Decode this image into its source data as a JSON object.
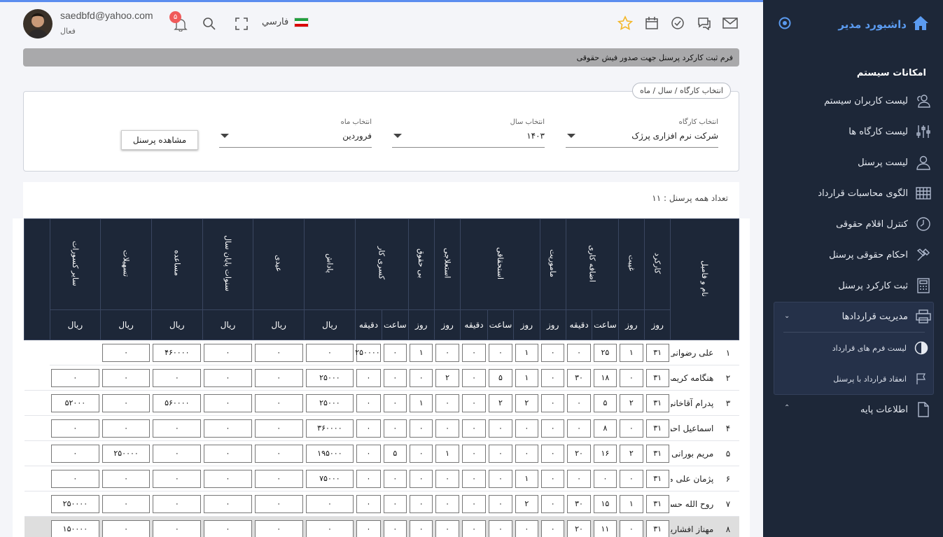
{
  "sidebar": {
    "brand": "داشبورد مدیر",
    "section_title": "امکانات سیستم",
    "items": [
      {
        "label": "لیست کاربران سیستم",
        "icon": "users-icon"
      },
      {
        "label": "لیست کارگاه ها",
        "icon": "sliders-icon"
      },
      {
        "label": "لیست پرسنل",
        "icon": "user-icon"
      },
      {
        "label": "الگوی محاسبات قرارداد",
        "icon": "table-icon"
      },
      {
        "label": "کنترل اقلام حقوقی",
        "icon": "clock-icon"
      },
      {
        "label": "احکام حقوقی پرسنل",
        "icon": "tools-icon"
      },
      {
        "label": "ثبت کارکرد پرسنل",
        "icon": "calculator-icon"
      }
    ],
    "group": {
      "label": "مدیریت قراردادها",
      "icon": "printer-icon",
      "subitems": [
        {
          "label": "لیست فرم های قرارداد",
          "icon": "half-circle-icon"
        },
        {
          "label": "انعقاد قرارداد با پرسنل",
          "icon": "flag-icon"
        }
      ]
    },
    "base": {
      "label": "اطلاعات پایه",
      "icon": "file-icon"
    }
  },
  "header": {
    "email": "saedbfd@yahoo.com",
    "status": "فعال",
    "notification_count": "۵",
    "language": "فارسي"
  },
  "page_title": "فرم ثبت کارکرد پرسنل جهت صدور فیش حقوقی",
  "filter": {
    "legend": "انتخاب کارگاه / سال / ماه",
    "workshop_label": "انتخاب کارگاه",
    "workshop_value": "شرکت نرم افزاری پرژک",
    "year_label": "انتخاب سال",
    "year_value": "۱۴۰۳",
    "month_label": "انتخاب ماه",
    "month_value": "فروردین",
    "view_button": "مشاهده پرسنل"
  },
  "count_text": "تعداد همه پرسنل : ۱۱",
  "table": {
    "name_header": "نام و فامیل",
    "groups": [
      {
        "label": "کارکرد",
        "units": [
          "روز"
        ]
      },
      {
        "label": "غیبت",
        "units": [
          "روز"
        ]
      },
      {
        "label": "اضافه کاری",
        "units": [
          "ساعت",
          "دقیقه"
        ]
      },
      {
        "label": "ماموریت",
        "units": [
          "روز"
        ]
      },
      {
        "label": "استحقاقی",
        "units": [
          "روز",
          "ساعت",
          "دقیقه"
        ]
      },
      {
        "label": "استعلاجی",
        "units": [
          "روز"
        ]
      },
      {
        "label": "بی حقوق",
        "units": [
          "روز"
        ]
      },
      {
        "label": "کسری کار",
        "units": [
          "ساعت",
          "دقیقه"
        ]
      },
      {
        "label": "پاداش",
        "units": [
          "ریال"
        ]
      },
      {
        "label": "عیدی",
        "units": [
          "ریال"
        ]
      },
      {
        "label": "سنوات پایان سال",
        "units": [
          "ریال"
        ]
      },
      {
        "label": "مساعده",
        "units": [
          "ریال"
        ]
      },
      {
        "label": "تسهیلات",
        "units": [
          "ریال"
        ]
      },
      {
        "label": "سایر کسورات",
        "units": [
          "ریال"
        ]
      }
    ],
    "rows": [
      {
        "num": "۱",
        "name": "علی رضوانی فرد",
        "vals": [
          "۳۱",
          "۱",
          "۲۵",
          "۰",
          "۰",
          "۱",
          "۰",
          "۰",
          "۰",
          "۱",
          "۰",
          "۲۵۰۰۰۰",
          "۰",
          "۰",
          "۰",
          "۴۶۰۰۰۰",
          "۰"
        ]
      },
      {
        "num": "۲",
        "name": "هنگامه کریمی",
        "vals": [
          "۳۱",
          "۰",
          "۱۸",
          "۳۰",
          "۰",
          "۱",
          "۵",
          "۰",
          "۲",
          "۰",
          "۰",
          "۰",
          "۲۵۰۰۰",
          "۰",
          "۰",
          "۰",
          "۰",
          "۰"
        ]
      },
      {
        "num": "۳",
        "name": "پدرام آقاخانی",
        "vals": [
          "۳۱",
          "۲",
          "۵",
          "۰",
          "۰",
          "۲",
          "۲",
          "۰",
          "۰",
          "۱",
          "۰",
          "۰",
          "۲۵۰۰۰",
          "۰",
          "۰",
          "۵۶۰۰۰۰",
          "۰",
          "۵۲۰۰۰"
        ]
      },
      {
        "num": "۴",
        "name": "اسماعیل احمدی",
        "vals": [
          "۳۱",
          "۰",
          "۸",
          "۰",
          "۰",
          "۰",
          "۰",
          "۰",
          "۰",
          "۰",
          "۰",
          "۰",
          "۳۶۰۰۰۰",
          "۰",
          "۰",
          "۰",
          "۰",
          "۰"
        ]
      },
      {
        "num": "۵",
        "name": "مریم بورانی",
        "vals": [
          "۳۱",
          "۲",
          "۱۶",
          "۲۰",
          "۰",
          "۰",
          "۰",
          "۰",
          "۱",
          "۰",
          "۵",
          "۰",
          "۱۹۵۰۰۰",
          "۰",
          "۰",
          "۰",
          "۲۵۰۰۰۰",
          "۰"
        ]
      },
      {
        "num": "۶",
        "name": "پژمان علی مرادی",
        "vals": [
          "۳۱",
          "۰",
          "۰",
          "۰",
          "۰",
          "۱",
          "۰",
          "۰",
          "۰",
          "۰",
          "۰",
          "۰",
          "۷۵۰۰۰",
          "۰",
          "۰",
          "۰",
          "۰",
          "۰"
        ]
      },
      {
        "num": "۷",
        "name": "روح الله حسینی",
        "vals": [
          "۳۱",
          "۱",
          "۱۵",
          "۳۰",
          "۰",
          "۲",
          "۰",
          "۰",
          "۰",
          "۰",
          "۰",
          "۰",
          "۰",
          "۰",
          "۰",
          "۰",
          "۰",
          "۲۵۰۰۰۰"
        ]
      },
      {
        "num": "۸",
        "name": "مهناز افشاریان",
        "vals": [
          "۳۱",
          "۰",
          "۱۱",
          "۲۰",
          "۰",
          "۰",
          "۰",
          "۰",
          "۰",
          "۰",
          "۰",
          "۰",
          "۰",
          "۰",
          "۰",
          "۰",
          "۰",
          "۱۵۰۰۰۰"
        ]
      }
    ]
  }
}
